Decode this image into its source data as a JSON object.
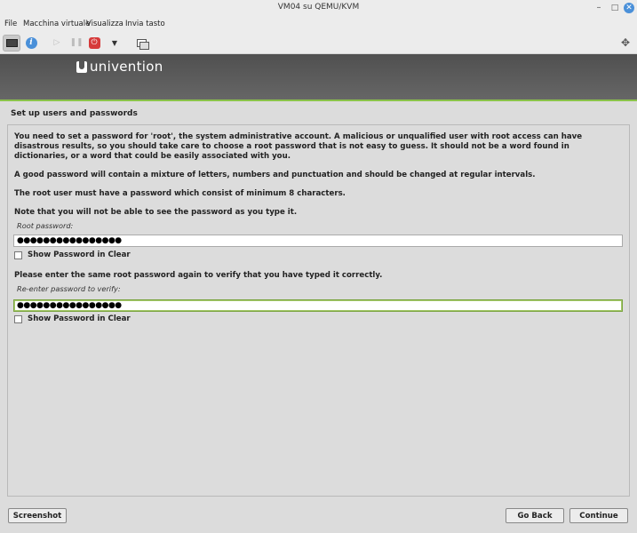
{
  "window": {
    "title": "VM04 su QEMU/KVM",
    "controls": {
      "minimize": "–",
      "maximize": "□",
      "close": "✕"
    }
  },
  "menubar": {
    "items": [
      "File",
      "Macchina virtuale",
      "Visualizza",
      "Invia tasto"
    ]
  },
  "toolbar": {
    "icons": [
      "console-icon",
      "info-icon",
      "play-icon",
      "pause-icon",
      "power-icon",
      "dropdown-icon",
      "snapshot-icon",
      "fullscreen-icon"
    ]
  },
  "branding": {
    "logo_text": "univention"
  },
  "installer": {
    "section_title": "Set up users and passwords",
    "paragraphs": [
      "You need to set a password for 'root', the system administrative account. A malicious or unqualified user with root access can have disastrous results, so you should take care to choose a root password that is not easy to guess. It should not be a word found in dictionaries, or a word that could be easily associated with you.",
      "A good password will contain a mixture of letters, numbers and punctuation and should be changed at regular intervals.",
      "The root user must have a password which consist of minimum 8 characters.",
      "Note that you will not be able to see the password as you type it."
    ],
    "root_password": {
      "label": "Root password:",
      "value": "●●●●●●●●●●●●●●●●"
    },
    "show_password_1": {
      "label": "Show Password in Clear",
      "checked": false
    },
    "verify_prompt": "Please enter the same root password again to verify that you have typed it correctly.",
    "verify_password": {
      "label": "Re-enter password to verify:",
      "value": "●●●●●●●●●●●●●●●●"
    },
    "show_password_2": {
      "label": "Show Password in Clear",
      "checked": false
    },
    "buttons": {
      "screenshot": "Screenshot",
      "back": "Go Back",
      "continue": "Continue"
    }
  },
  "colors": {
    "accent_green": "#8bc34a",
    "banner_gray": "#5a5a5a",
    "power_red": "#d63a3a",
    "info_blue": "#4a90d9"
  }
}
